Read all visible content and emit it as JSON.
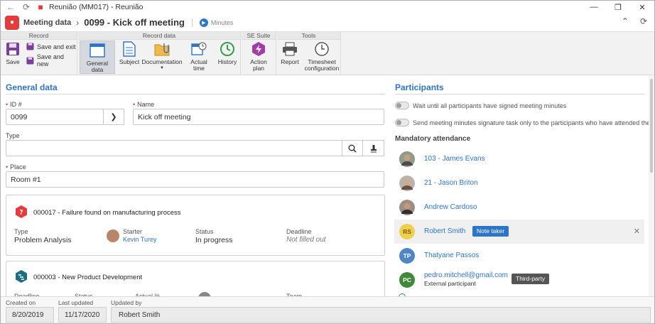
{
  "window": {
    "title": "Reunião (MM017) - Reunião"
  },
  "header": {
    "breadcrumb_root": "Meeting data",
    "title": "0099 - Kick off meeting",
    "status_label": "Minutes"
  },
  "ribbon": {
    "groups": {
      "record": "Record",
      "record_data": "Record data",
      "se_suite": "SE Suite",
      "tools": "Tools"
    },
    "save": "Save",
    "save_and_exit": "Save and exit",
    "save_and_new": "Save and new",
    "general_data": "General data",
    "subject": "Subject",
    "documentation": "Documentation",
    "actual_time": "Actual time",
    "history": "History",
    "action_plan": "Action plan",
    "report": "Report",
    "timesheet_line1": "Timesheet",
    "timesheet_line2": "configuration"
  },
  "general": {
    "section_title": "General data",
    "id_label": "ID #",
    "id_value": "0099",
    "name_label": "Name",
    "name_value": "Kick off meeting",
    "type_label": "Type",
    "type_value": "",
    "place_label": "Place",
    "place_value": "Room #1"
  },
  "cards": [
    {
      "title": "000017 - Failure found on manufacturing process",
      "type_label": "Type",
      "type_value": "Problem Analysis",
      "starter_label": "Starter",
      "starter_value": "Kevin Turey",
      "status_label": "Status",
      "status_value": "In progress",
      "deadline_label": "Deadline",
      "deadline_value": "Not filled out"
    },
    {
      "title": "000003 - New Product Development",
      "deadline_label": "Deadline",
      "status_label": "Status",
      "actual_label": "Actual %",
      "team_label": "Team"
    }
  ],
  "participants": {
    "section_title": "Participants",
    "toggle1": "Wait until all participants have signed meeting minutes",
    "toggle2": "Send meeting minutes signature task only to the participants who have attended the meeting",
    "mandatory_title": "Mandatory attendance",
    "list": [
      {
        "name": "103 - James Evans",
        "initials": ""
      },
      {
        "name": "21 - Jason Briton",
        "initials": ""
      },
      {
        "name": "Andrew Cardoso",
        "initials": ""
      },
      {
        "name": "Robert Smith",
        "initials": "RS",
        "badge": "Note taker"
      },
      {
        "name": "Thatyane Passos",
        "initials": "TP"
      },
      {
        "name": "pedro.mitchell@gmail.com",
        "initials": "PC",
        "sub": "External participant",
        "badge": "Third-party"
      }
    ]
  },
  "footer": {
    "created_on_label": "Created on",
    "created_on_value": "8/20/2019",
    "last_updated_label": "Last updated",
    "last_updated_value": "11/17/2020",
    "updated_by_label": "Updated by",
    "updated_by_value": "Robert Smith"
  },
  "colors": {
    "accent": "#2e75c8",
    "brand": "#e23c3c",
    "avatar_rs": "#f0cf4f",
    "avatar_tp": "#4f86c6",
    "avatar_pc": "#3f8a3a",
    "badge_note": "#2e75c8",
    "badge_third": "#555555"
  }
}
